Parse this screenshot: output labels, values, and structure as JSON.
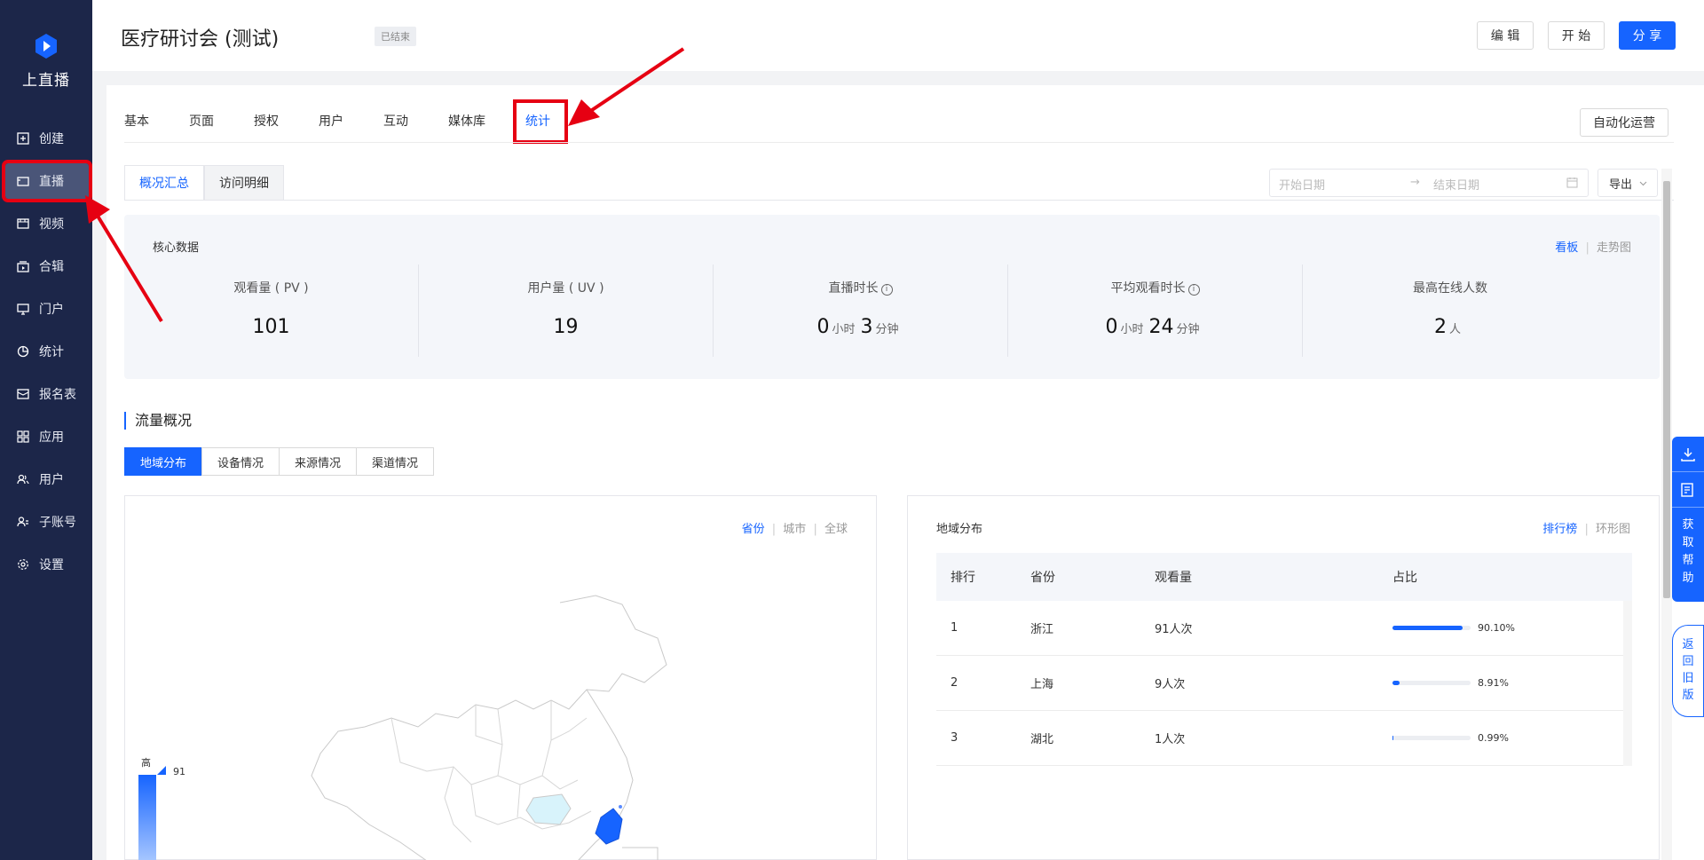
{
  "app": {
    "logo_text": "上直播"
  },
  "sidebar": {
    "items": [
      {
        "label": "创建",
        "icon": "plus-square-icon"
      },
      {
        "label": "直播",
        "icon": "video-camera-icon"
      },
      {
        "label": "视频",
        "icon": "film-icon"
      },
      {
        "label": "合辑",
        "icon": "collection-icon"
      },
      {
        "label": "门户",
        "icon": "monitor-icon"
      },
      {
        "label": "统计",
        "icon": "pie-chart-icon"
      },
      {
        "label": "报名表",
        "icon": "form-icon"
      },
      {
        "label": "应用",
        "icon": "apps-grid-icon"
      },
      {
        "label": "用户",
        "icon": "users-icon"
      },
      {
        "label": "子账号",
        "icon": "sub-account-icon"
      },
      {
        "label": "设置",
        "icon": "gear-icon"
      }
    ],
    "active_index": 1
  },
  "header": {
    "title": "医疗研讨会 (测试)",
    "status_badge": "已结束",
    "edit_label": "编 辑",
    "start_label": "开 始",
    "share_label": "分 享"
  },
  "tabs": [
    "基本",
    "页面",
    "授权",
    "用户",
    "互动",
    "媒体库",
    "统计"
  ],
  "active_tab": "统计",
  "auto_ops_label": "自动化运营",
  "subtabs": [
    "概况汇总",
    "访问明细"
  ],
  "date_range": {
    "start_placeholder": "开始日期",
    "separator": "→",
    "end_placeholder": "结束日期"
  },
  "export_label": "导出",
  "core": {
    "title": "核心数据",
    "view_board": "看板",
    "view_trend": "走势图",
    "metrics": [
      {
        "label": "观看量 ( PV )",
        "value": "101"
      },
      {
        "label": "用户量 ( UV )",
        "value": "19"
      },
      {
        "label": "直播时长",
        "hours": "0",
        "hours_unit": "小时",
        "minutes": "3",
        "minutes_unit": "分钟"
      },
      {
        "label": "平均观看时长",
        "hours": "0",
        "hours_unit": "小时",
        "minutes": "24",
        "minutes_unit": "分钟"
      },
      {
        "label": "最高在线人数",
        "value": "2",
        "unit": "人"
      }
    ]
  },
  "traffic": {
    "title": "流量概况",
    "tabs": [
      "地域分布",
      "设备情况",
      "来源情况",
      "渠道情况"
    ],
    "map_scope": [
      "省份",
      "城市",
      "全球"
    ],
    "legend_high": "高",
    "legend_max": "91",
    "region": {
      "title": "地域分布",
      "view_rank": "排行榜",
      "view_ring": "环形图",
      "columns": [
        "排行",
        "省份",
        "观看量",
        "占比"
      ],
      "rows": [
        {
          "rank": "1",
          "province": "浙江",
          "views": "91人次",
          "pct": "90.10%",
          "ratio": 0.901
        },
        {
          "rank": "2",
          "province": "上海",
          "views": "9人次",
          "pct": "8.91%",
          "ratio": 0.0891
        },
        {
          "rank": "3",
          "province": "湖北",
          "views": "1人次",
          "pct": "0.99%",
          "ratio": 0.0099
        }
      ]
    }
  },
  "float": {
    "help_text": "获取帮助",
    "old_version": "返回旧版"
  },
  "colors": {
    "sidebar_bg": "#1c2649",
    "primary": "#1664ff",
    "annotation_red": "#e60012"
  }
}
